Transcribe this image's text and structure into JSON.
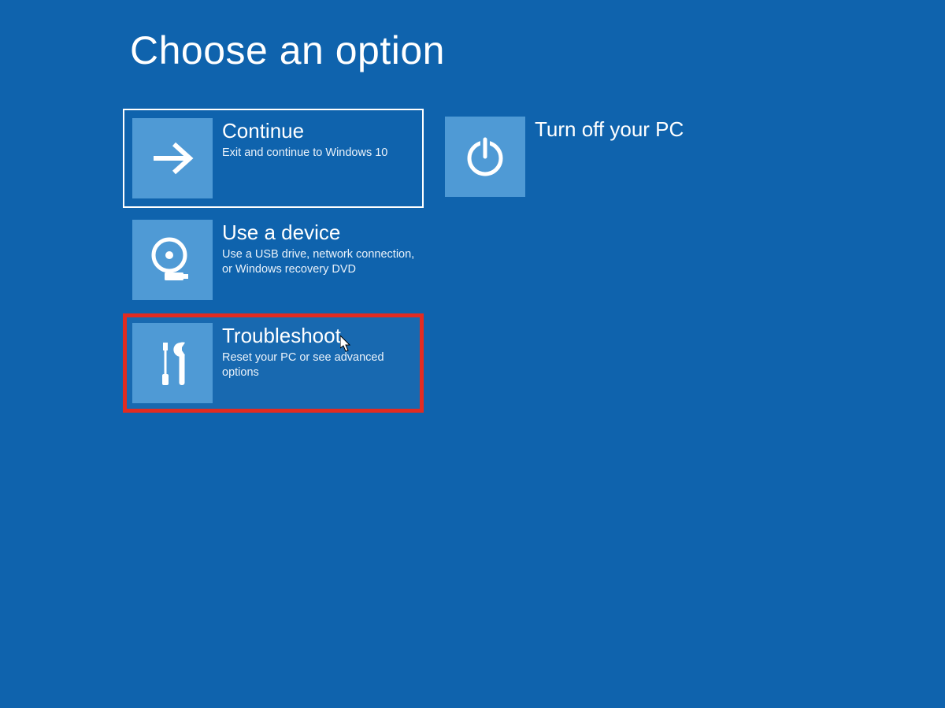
{
  "heading": "Choose an option",
  "tiles": {
    "continue": {
      "title": "Continue",
      "desc": "Exit and continue to Windows 10"
    },
    "device": {
      "title": "Use a device",
      "desc": "Use a USB drive, network connection, or Windows recovery DVD"
    },
    "troubleshoot": {
      "title": "Troubleshoot",
      "desc": "Reset your PC or see advanced options"
    },
    "power": {
      "title": "Turn off your PC"
    }
  }
}
